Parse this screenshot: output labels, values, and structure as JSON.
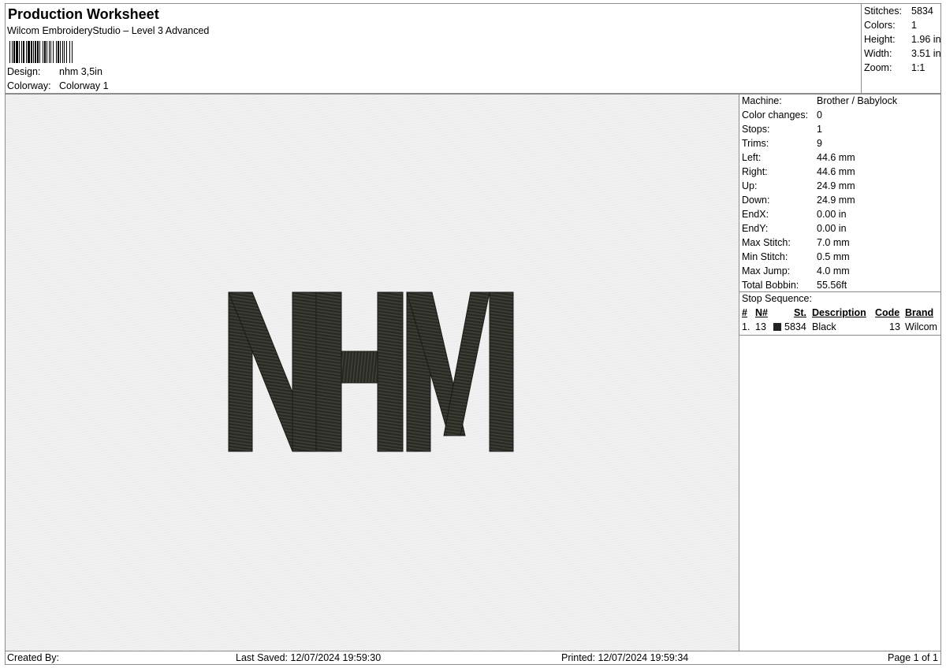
{
  "header": {
    "title": "Production Worksheet",
    "software": "Wilcom EmbroideryStudio – Level 3 Advanced",
    "design_label": "Design:",
    "design_value": "nhm 3,5in",
    "colorway_label": "Colorway:",
    "colorway_value": "Colorway 1"
  },
  "summary": {
    "stitches_label": "Stitches:",
    "stitches_value": "5834",
    "colors_label": "Colors:",
    "colors_value": "1",
    "height_label": "Height:",
    "height_value": "1.96 in",
    "width_label": "Width:",
    "width_value": "3.51 in",
    "zoom_label": "Zoom:",
    "zoom_value": "1:1"
  },
  "machine_info": [
    {
      "label": "Machine:",
      "value": "Brother / Babylock"
    },
    {
      "label": "Color changes:",
      "value": "0"
    },
    {
      "label": "Stops:",
      "value": "1"
    },
    {
      "label": "Trims:",
      "value": "9"
    },
    {
      "label": "Left:",
      "value": "44.6 mm"
    },
    {
      "label": "Right:",
      "value": "44.6 mm"
    },
    {
      "label": "Up:",
      "value": "24.9 mm"
    },
    {
      "label": "Down:",
      "value": "24.9 mm"
    },
    {
      "label": "EndX:",
      "value": "0.00 in"
    },
    {
      "label": "EndY:",
      "value": "0.00 in"
    },
    {
      "label": "Max Stitch:",
      "value": "7.0 mm"
    },
    {
      "label": "Min Stitch:",
      "value": "0.5 mm"
    },
    {
      "label": "Max Jump:",
      "value": "4.0 mm"
    },
    {
      "label": "Total Bobbin:",
      "value": "55.56ft"
    }
  ],
  "stop_sequence": {
    "title": "Stop Sequence:",
    "columns": [
      "#",
      "N#",
      "St.",
      "Description",
      "Code",
      "Brand"
    ],
    "rows": [
      {
        "num": "1.",
        "needle": "13",
        "stitches": "5834",
        "description": "Black",
        "code": "13",
        "brand": "Wilcom",
        "color": "#232323"
      }
    ]
  },
  "preview": {
    "design_text": "NHM",
    "thread_color": "#232320"
  },
  "footer": {
    "created_by": "Created By:",
    "last_saved": "Last Saved: 12/07/2024 19:59:30",
    "printed": "Printed: 12/07/2024 19:59:34",
    "page": "Page 1 of 1"
  }
}
